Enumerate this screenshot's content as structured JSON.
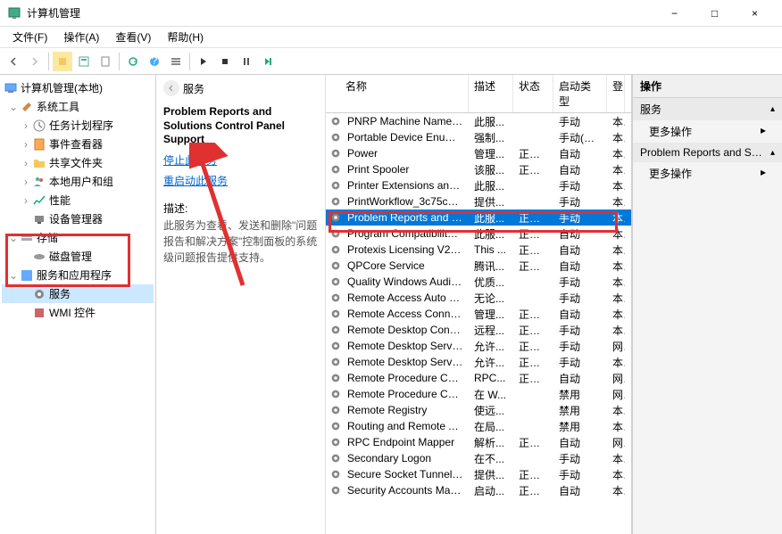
{
  "window": {
    "title": "计算机管理",
    "min_icon": "−",
    "max_icon": "□",
    "close_icon": "×"
  },
  "menu": {
    "file": "文件(F)",
    "action": "操作(A)",
    "view": "查看(V)",
    "help": "帮助(H)"
  },
  "tree": {
    "root": "计算机管理(本地)",
    "system_tools": "系统工具",
    "task_scheduler": "任务计划程序",
    "event_viewer": "事件查看器",
    "shared_folders": "共享文件夹",
    "local_users": "本地用户和组",
    "performance": "性能",
    "device_manager": "设备管理器",
    "storage": "存储",
    "disk_mgmt": "磁盘管理",
    "services_apps": "服务和应用程序",
    "services": "服务",
    "wmi": "WMI 控件"
  },
  "detail": {
    "header": "服务",
    "title": "Problem Reports and Solutions Control Panel Support",
    "stop_link": "停止此服务",
    "restart_link": "重启动此服务",
    "desc_label": "描述:",
    "desc": "此服务为查看、发送和删除\"问题报告和解决方案\"控制面板的系统级问题报告提供支持。"
  },
  "columns": {
    "name": "名称",
    "desc": "描述",
    "status": "状态",
    "start": "启动类型",
    "as": "登"
  },
  "services": [
    {
      "n": "PNRP Machine Name Pu...",
      "d": "此服...",
      "s": "",
      "t": "手动",
      "a": "本"
    },
    {
      "n": "Portable Device Enumera...",
      "d": "强制...",
      "s": "",
      "t": "手动(触发...",
      "a": "本"
    },
    {
      "n": "Power",
      "d": "管理...",
      "s": "正在...",
      "t": "自动",
      "a": "本"
    },
    {
      "n": "Print Spooler",
      "d": "该服...",
      "s": "正在...",
      "t": "自动",
      "a": "本"
    },
    {
      "n": "Printer Extensions and N...",
      "d": "此服...",
      "s": "",
      "t": "手动",
      "a": "本"
    },
    {
      "n": "PrintWorkflow_3c75c03d",
      "d": "提供...",
      "s": "",
      "t": "手动",
      "a": "本"
    },
    {
      "n": "Problem Reports and Sol...",
      "d": "此服...",
      "s": "正在...",
      "t": "手动",
      "a": "本",
      "sel": true
    },
    {
      "n": "Program Compatibility A...",
      "d": "此服...",
      "s": "正在...",
      "t": "自动",
      "a": "本"
    },
    {
      "n": "Protexis Licensing V2 x64",
      "d": "This ...",
      "s": "正在...",
      "t": "自动",
      "a": "本"
    },
    {
      "n": "QPCore Service",
      "d": "腾讯...",
      "s": "正在...",
      "t": "自动",
      "a": "本"
    },
    {
      "n": "Quality Windows Audio V...",
      "d": "优质...",
      "s": "",
      "t": "手动",
      "a": "本"
    },
    {
      "n": "Remote Access Auto Con...",
      "d": "无论...",
      "s": "",
      "t": "手动",
      "a": "本"
    },
    {
      "n": "Remote Access Connecti...",
      "d": "管理...",
      "s": "正在...",
      "t": "自动",
      "a": "本"
    },
    {
      "n": "Remote Desktop Configu...",
      "d": "远程...",
      "s": "正在...",
      "t": "手动",
      "a": "本"
    },
    {
      "n": "Remote Desktop Services",
      "d": "允许...",
      "s": "正在...",
      "t": "手动",
      "a": "网"
    },
    {
      "n": "Remote Desktop Service...",
      "d": "允许...",
      "s": "正在...",
      "t": "手动",
      "a": "本"
    },
    {
      "n": "Remote Procedure Call (...",
      "d": "RPC...",
      "s": "正在...",
      "t": "自动",
      "a": "网"
    },
    {
      "n": "Remote Procedure Call (...",
      "d": "在 W...",
      "s": "",
      "t": "禁用",
      "a": "网"
    },
    {
      "n": "Remote Registry",
      "d": "使远...",
      "s": "",
      "t": "禁用",
      "a": "本"
    },
    {
      "n": "Routing and Remote Acc...",
      "d": "在局...",
      "s": "",
      "t": "禁用",
      "a": "本"
    },
    {
      "n": "RPC Endpoint Mapper",
      "d": "解析...",
      "s": "正在...",
      "t": "自动",
      "a": "网"
    },
    {
      "n": "Secondary Logon",
      "d": "在不...",
      "s": "",
      "t": "手动",
      "a": "本"
    },
    {
      "n": "Secure Socket Tunneling ...",
      "d": "提供...",
      "s": "正在...",
      "t": "手动",
      "a": "本"
    },
    {
      "n": "Security Accounts Manag...",
      "d": "启动...",
      "s": "正在...",
      "t": "自动",
      "a": "本"
    }
  ],
  "actions": {
    "header": "操作",
    "services_group": "服务",
    "more_actions": "更多操作",
    "selected_group": "Problem Reports and Sol..."
  }
}
